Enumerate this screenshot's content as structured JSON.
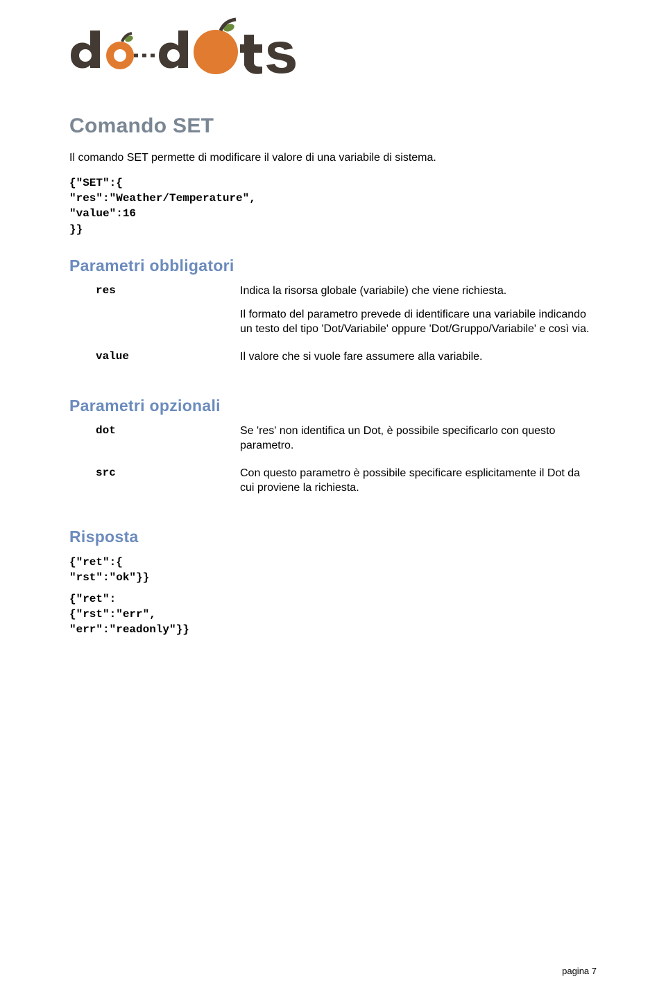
{
  "section": {
    "title": "Comando SET",
    "intro": "Il comando SET permette di modificare il valore di una variabile di sistema.",
    "example_code": "{\"SET\":{\n\"res\":\"Weather/Temperature\",\n\"value\":16\n}}"
  },
  "params_required": {
    "heading": "Parametri obbligatori",
    "items": [
      {
        "key": "res",
        "desc_p1": "Indica la risorsa globale (variabile) che viene richiesta.",
        "desc_p2": "Il formato del parametro prevede di identificare una variabile indicando un testo del tipo 'Dot/Variabile' oppure 'Dot/Gruppo/Variabile' e così via."
      },
      {
        "key": "value",
        "desc_p1": "Il valore che si vuole fare assumere alla variabile."
      }
    ]
  },
  "params_optional": {
    "heading": "Parametri opzionali",
    "items": [
      {
        "key": "dot",
        "desc_p1": "Se 'res' non identifica un Dot, è possibile specificarlo con questo parametro."
      },
      {
        "key": "src",
        "desc_p1": "Con questo parametro è possibile specificare esplicitamente il Dot da cui proviene la richiesta."
      }
    ]
  },
  "response": {
    "heading": "Risposta",
    "code1": "{\"ret\":{\n\"rst\":\"ok\"}}",
    "code2": "{\"ret\":\n{\"rst\":\"err\",\n\"err\":\"readonly\"}}"
  },
  "footer": {
    "page_label": "pagina 7"
  }
}
